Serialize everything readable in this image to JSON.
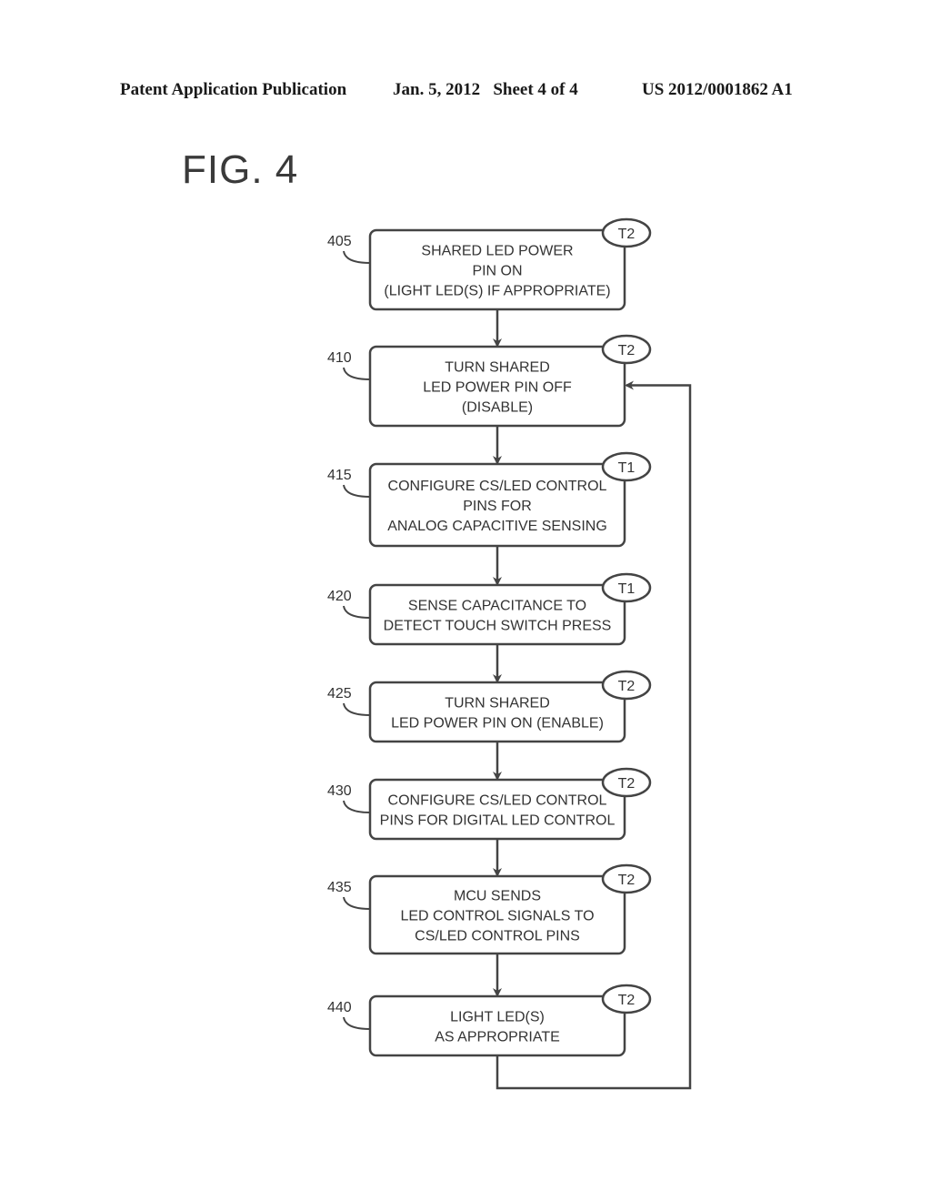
{
  "header": {
    "publication": "Patent Application Publication",
    "date_sheet": "Jan. 5, 2012   Sheet 4 of 4",
    "patent_number": "US 2012/0001862 A1"
  },
  "figure": {
    "title": "FIG. 4"
  },
  "flowchart": {
    "steps": [
      {
        "ref": "405",
        "tag": "T2",
        "lines": [
          "SHARED LED POWER",
          "PIN ON",
          "(LIGHT LED(S) IF APPROPRIATE)"
        ]
      },
      {
        "ref": "410",
        "tag": "T2",
        "lines": [
          "TURN SHARED",
          "LED POWER PIN OFF",
          "(DISABLE)"
        ]
      },
      {
        "ref": "415",
        "tag": "T1",
        "lines": [
          "CONFIGURE CS/LED CONTROL",
          "PINS FOR",
          "ANALOG CAPACITIVE SENSING"
        ]
      },
      {
        "ref": "420",
        "tag": "T1",
        "lines": [
          "SENSE CAPACITANCE TO",
          "DETECT TOUCH SWITCH PRESS"
        ]
      },
      {
        "ref": "425",
        "tag": "T2",
        "lines": [
          "TURN SHARED",
          "LED POWER PIN ON (ENABLE)"
        ]
      },
      {
        "ref": "430",
        "tag": "T2",
        "lines": [
          "CONFIGURE CS/LED CONTROL",
          "PINS FOR DIGITAL LED CONTROL"
        ]
      },
      {
        "ref": "435",
        "tag": "T2",
        "lines": [
          "MCU SENDS",
          "LED CONTROL SIGNALS TO",
          "CS/LED CONTROL PINS"
        ]
      },
      {
        "ref": "440",
        "tag": "T2",
        "lines": [
          "LIGHT LED(S)",
          "AS APPROPRIATE"
        ]
      }
    ],
    "loop": {
      "from": "440",
      "to": "410"
    }
  }
}
